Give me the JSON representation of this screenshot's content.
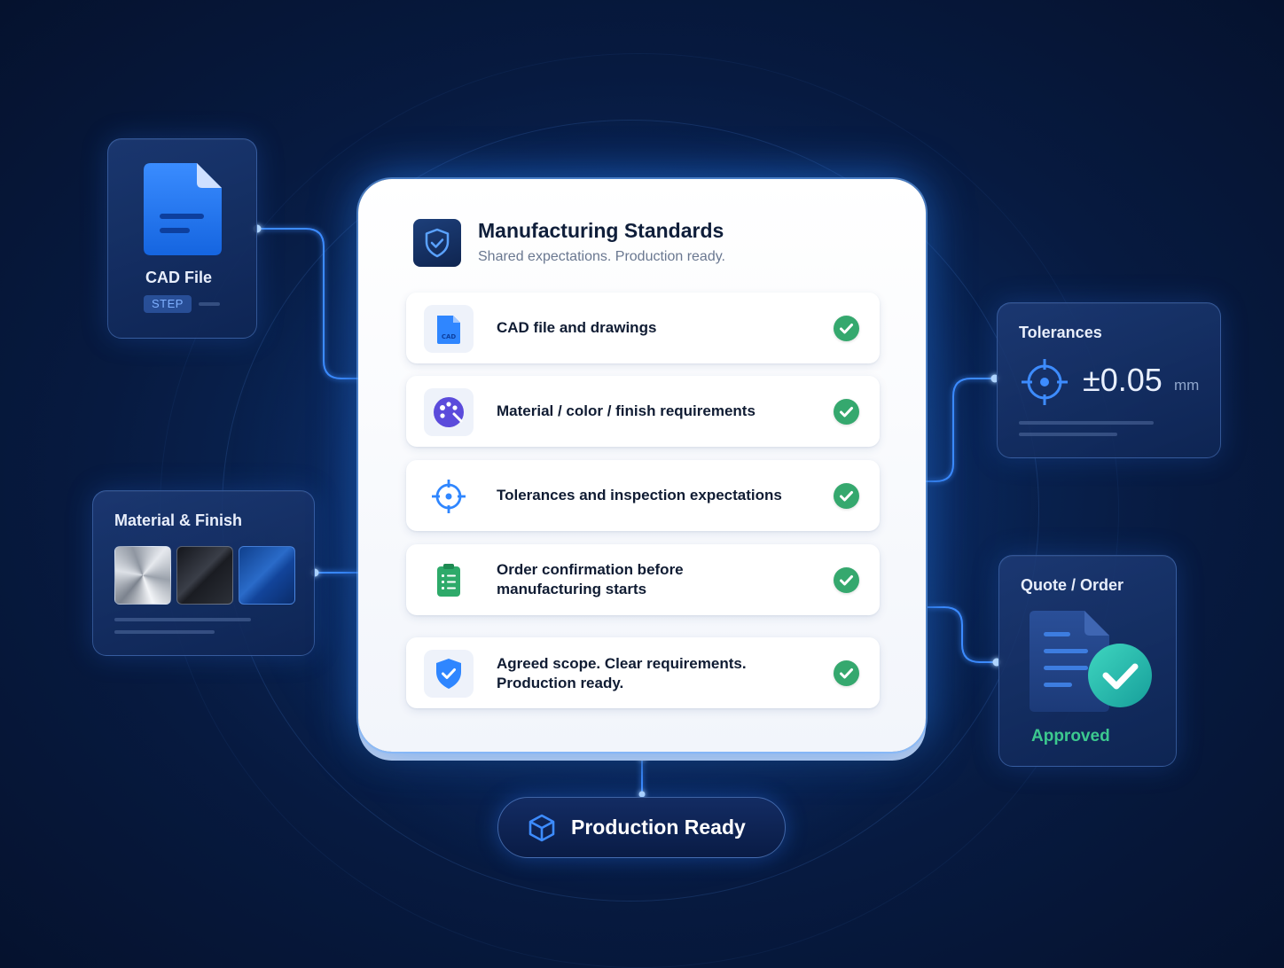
{
  "cad_card": {
    "title": "CAD File",
    "badge": "STEP",
    "icon": "document-icon"
  },
  "material_card": {
    "title": "Material & Finish",
    "swatches": [
      "brushed-silver",
      "dark-graphite",
      "blue-anodized"
    ]
  },
  "tolerance_card": {
    "title": "Tolerances",
    "value": "±0.05",
    "unit": "mm",
    "icon": "crosshair-icon"
  },
  "quote_card": {
    "title": "Quote / Order",
    "status": "Approved",
    "icon": "approved-document-icon"
  },
  "main_card": {
    "title": "Manufacturing Standards",
    "subtitle": "Shared expectations. Production ready.",
    "icon": "shield-check-icon",
    "items": [
      {
        "label": "CAD file and drawings",
        "icon": "cad-file-icon",
        "checked": true
      },
      {
        "label": "Material / color / finish requirements",
        "icon": "palette-icon",
        "checked": true
      },
      {
        "label": "Tolerances and inspection expectations",
        "icon": "crosshair-icon",
        "checked": true
      },
      {
        "label_line1": "Order confirmation before",
        "label_line2": "manufacturing starts",
        "icon": "clipboard-icon",
        "checked": true
      },
      {
        "label_line1": "Agreed scope. Clear requirements.",
        "label_line2": "Production ready.",
        "icon": "shield-icon",
        "checked": true
      }
    ]
  },
  "production_pill": {
    "label": "Production Ready",
    "icon": "cube-icon"
  },
  "colors": {
    "accent": "#1f7bff",
    "check": "#35a86e",
    "approved": "#3cc98f",
    "background": "#071a40"
  }
}
